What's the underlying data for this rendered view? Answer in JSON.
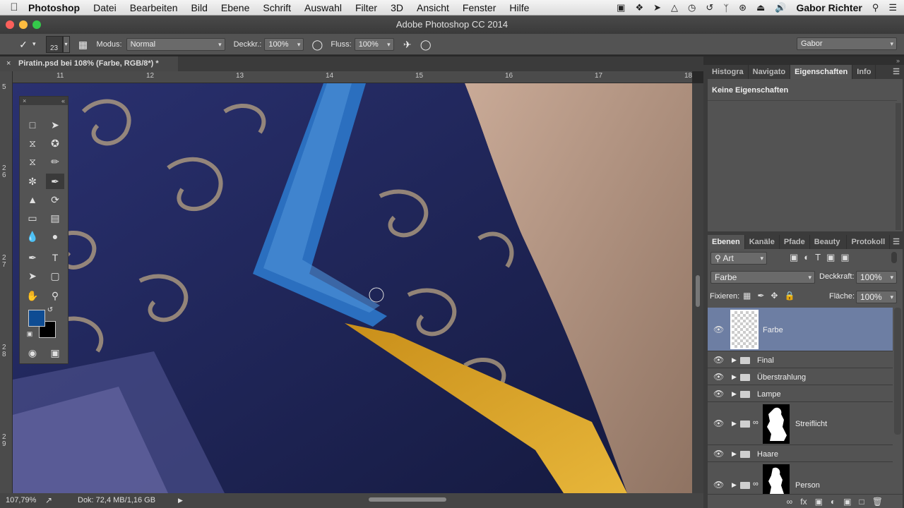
{
  "menubar": {
    "app": "Photoshop",
    "items": [
      "Datei",
      "Bearbeiten",
      "Bild",
      "Ebene",
      "Schrift",
      "Auswahl",
      "Filter",
      "3D",
      "Ansicht",
      "Fenster",
      "Hilfe"
    ],
    "user": "Gabor Richter"
  },
  "window": {
    "title": "Adobe Photoshop CC 2014"
  },
  "options": {
    "brush_size": "23",
    "modus_label": "Modus:",
    "modus_value": "Normal",
    "deckkr_label": "Deckkr.:",
    "deckkr_value": "100%",
    "fluss_label": "Fluss:",
    "fluss_value": "100%",
    "workspace": "Gabor"
  },
  "document": {
    "tab_title": "Piratin.psd bei 108% (Farbe, RGB/8*) *",
    "ruler_top": [
      "11",
      "12",
      "13",
      "14",
      "15",
      "16",
      "17",
      "18"
    ],
    "ruler_left": [
      "5",
      "2 6",
      "2 7",
      "2 8",
      "2 9"
    ]
  },
  "status": {
    "zoom": "107,79%",
    "doc_info": "Dok: 72,4 MB/1,16 GB"
  },
  "colors": {
    "foreground": "#0e4c93",
    "background": "#000000"
  },
  "properties": {
    "tabs": [
      "Histogra",
      "Navigato",
      "Eigenschaften",
      "Info"
    ],
    "active": "Eigenschaften",
    "message": "Keine Eigenschaften"
  },
  "layers_panel": {
    "tabs": [
      "Ebenen",
      "Kanäle",
      "Pfade",
      "Beauty Rei",
      "Protokoll"
    ],
    "active": "Ebenen",
    "filter": "Art",
    "blend_mode": "Farbe",
    "opacity_label": "Deckkraft:",
    "opacity_value": "100%",
    "lock_label": "Fixieren:",
    "fill_label": "Fläche:",
    "fill_value": "100%",
    "layers": [
      {
        "name": "Farbe",
        "selected": true
      },
      {
        "name": "Final"
      },
      {
        "name": "Überstrahlung"
      },
      {
        "name": "Lampe"
      },
      {
        "name": "Streiflicht"
      },
      {
        "name": "Haare"
      },
      {
        "name": "Person"
      }
    ]
  }
}
